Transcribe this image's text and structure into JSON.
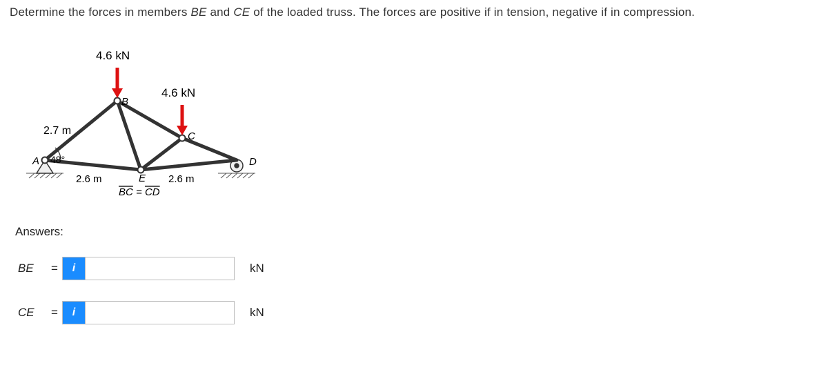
{
  "problem": {
    "prefix": "Determine the forces in members ",
    "m1": "BE",
    "mid1": " and ",
    "m2": "CE",
    "suffix": " of the loaded truss. The forces are positive if in tension, negative if in compression."
  },
  "figure": {
    "load_B": "4.6 kN",
    "load_C": "4.6 kN",
    "len_AB": "2.7 m",
    "angle_A": "48°",
    "len_AE": "2.6 m",
    "len_ED": "2.6 m",
    "bc_cd": "BC = CD",
    "labels": {
      "A": "A",
      "B": "B",
      "C": "C",
      "D": "D",
      "E": "E"
    }
  },
  "answers_heading": "Answers:",
  "rows": [
    {
      "symbol": "BE",
      "unit": "kN",
      "value": ""
    },
    {
      "symbol": "CE",
      "unit": "kN",
      "value": ""
    }
  ],
  "info_icon": "i",
  "equals": "="
}
